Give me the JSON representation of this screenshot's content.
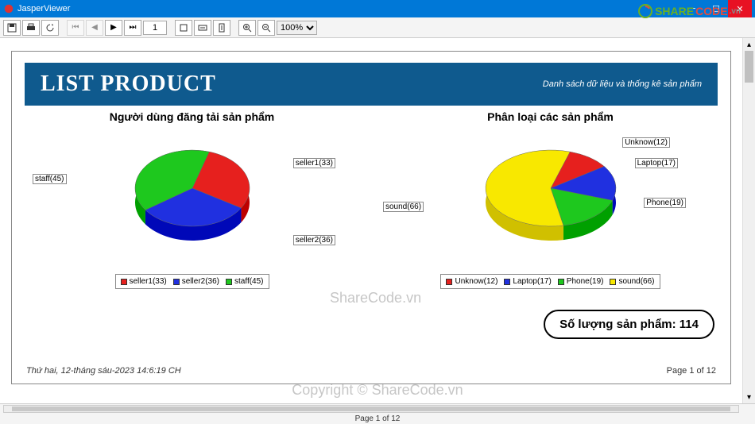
{
  "window": {
    "title": "JasperViewer"
  },
  "toolbar": {
    "page_value": "1",
    "zoom_value": "100%"
  },
  "logo": {
    "text_share": "SHARE",
    "text_code": "CODE",
    "suffix": ".vn"
  },
  "header": {
    "title": "LIST PRODUCT",
    "subtitle": "Danh sách dữ liệu và thống kê sản phẩm"
  },
  "chart1": {
    "title": "Người dùng đăng tải sản phẩm",
    "labels": {
      "seller1": "seller1(33)",
      "seller2": "seller2(36)",
      "staff": "staff(45)"
    }
  },
  "chart2": {
    "title": "Phân loại các sản phẩm",
    "labels": {
      "unknow": "Unknow(12)",
      "laptop": "Laptop(17)",
      "phone": "Phone(19)",
      "sound": "sound(66)"
    }
  },
  "countbox": {
    "text": "Số lượng sản phẩm: 114"
  },
  "footer": {
    "date": "Thứ hai, 12-tháng sáu-2023 14:6:19 CH",
    "page": "Page 1 of 12"
  },
  "status": {
    "page": "Page 1 of 12"
  },
  "watermark": {
    "center": "ShareCode.vn",
    "bottom": "Copyright © ShareCode.vn"
  },
  "colors": {
    "red": "#e6201e",
    "blue": "#2030e0",
    "green": "#1ec81e",
    "yellow": "#f8e800"
  },
  "chart_data": [
    {
      "type": "pie",
      "title": "Người dùng đăng tải sản phẩm",
      "series": [
        {
          "name": "seller1",
          "value": 33,
          "color": "#e6201e"
        },
        {
          "name": "seller2",
          "value": 36,
          "color": "#2030e0"
        },
        {
          "name": "staff",
          "value": 45,
          "color": "#1ec81e"
        }
      ]
    },
    {
      "type": "pie",
      "title": "Phân loại các sản phẩm",
      "series": [
        {
          "name": "Unknow",
          "value": 12,
          "color": "#e6201e"
        },
        {
          "name": "Laptop",
          "value": 17,
          "color": "#2030e0"
        },
        {
          "name": "Phone",
          "value": 19,
          "color": "#1ec81e"
        },
        {
          "name": "sound",
          "value": 66,
          "color": "#f8e800"
        }
      ]
    }
  ]
}
